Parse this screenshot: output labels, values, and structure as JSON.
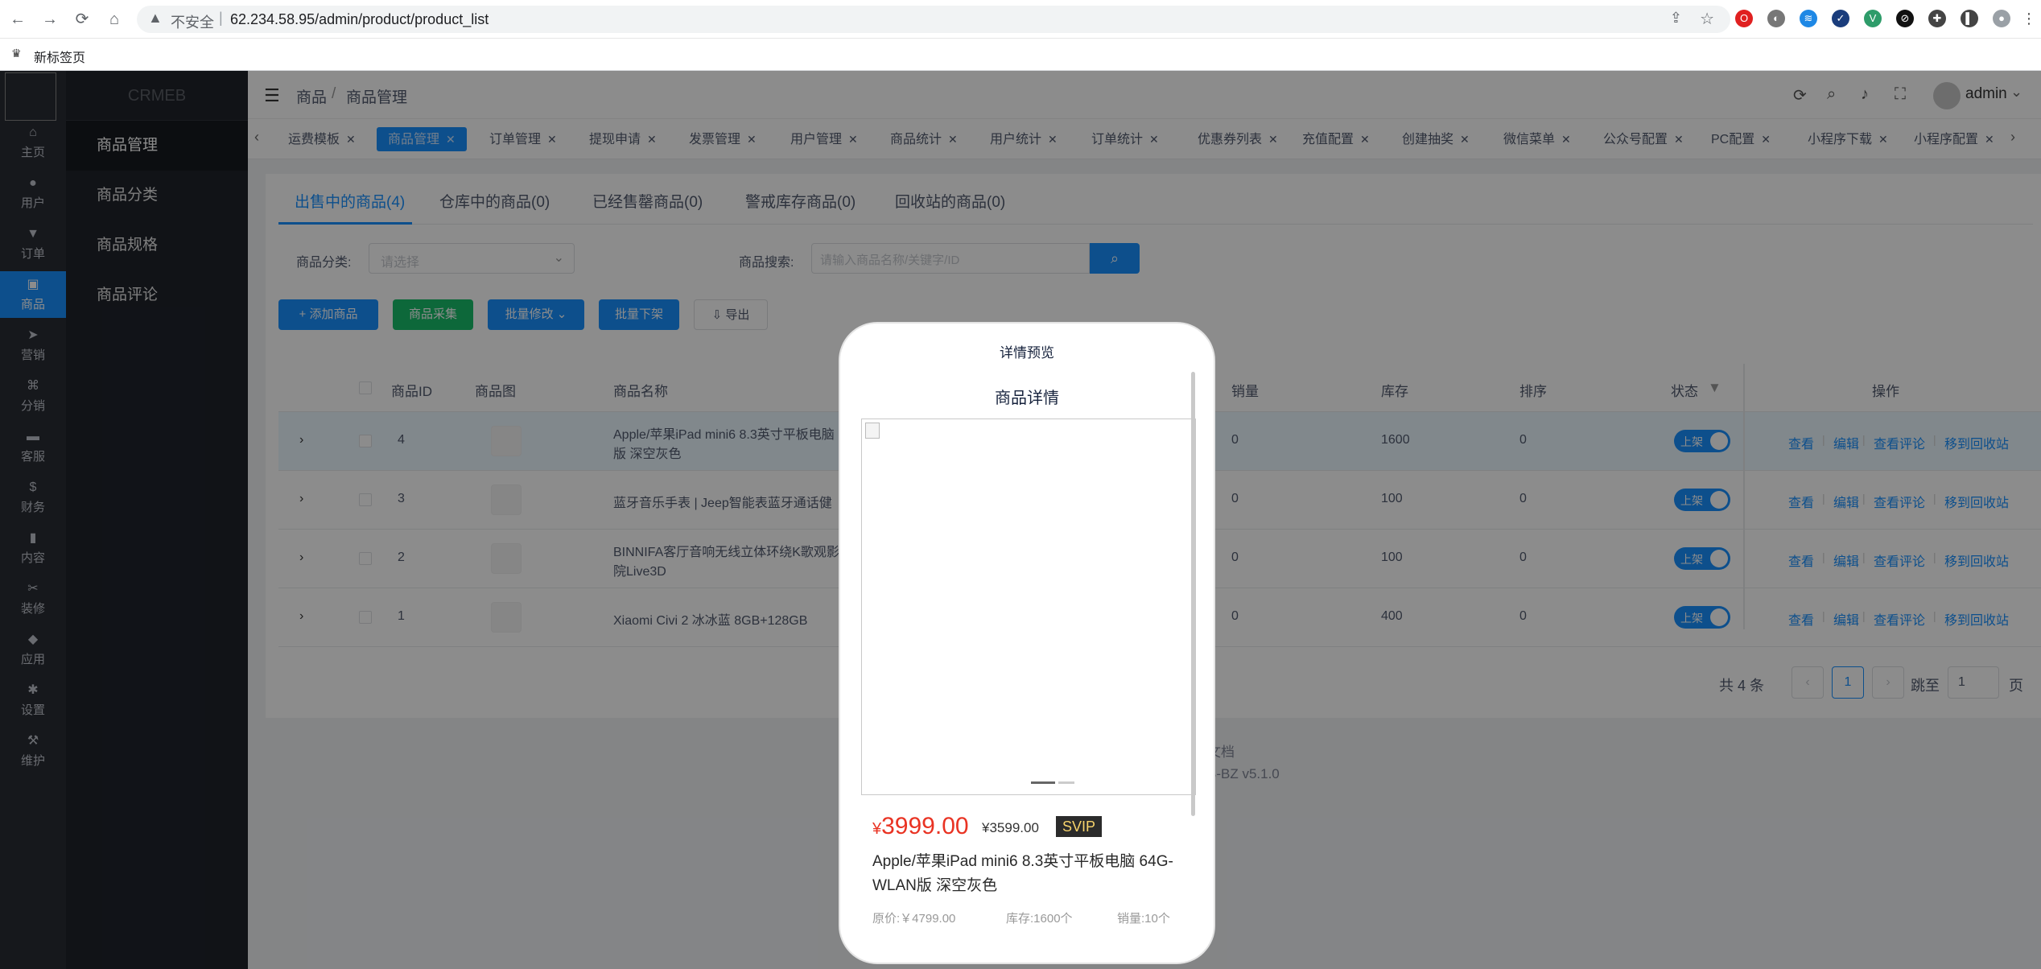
{
  "browser": {
    "back": "←",
    "forward": "→",
    "reload": "⟳",
    "home": "⌂",
    "security_icon": "warning-triangle-icon",
    "insecure_label": "不安全",
    "address_sep": "|",
    "url": "62.234.58.95/admin/product/product_list",
    "bookmark": "新标签页"
  },
  "app": {
    "brand": "CRMEB",
    "rail_items": [
      {
        "icon": "home-icon",
        "glyph": "⌂",
        "label": "主页"
      },
      {
        "icon": "user-icon",
        "glyph": "●",
        "label": "用户"
      },
      {
        "icon": "cart-icon",
        "glyph": "▼",
        "label": "订单"
      },
      {
        "icon": "goods-icon",
        "glyph": "▣",
        "label": "商品"
      },
      {
        "icon": "send-icon",
        "glyph": "➤",
        "label": "营销"
      },
      {
        "icon": "share-icon",
        "glyph": "⌘",
        "label": "分销"
      },
      {
        "icon": "chat-icon",
        "glyph": "▬",
        "label": "客服"
      },
      {
        "icon": "dollar-icon",
        "glyph": "$",
        "label": "财务"
      },
      {
        "icon": "book-icon",
        "glyph": "▮",
        "label": "内容"
      },
      {
        "icon": "tools-icon",
        "glyph": "✂",
        "label": "装修"
      },
      {
        "icon": "cube-icon",
        "glyph": "◆",
        "label": "应用"
      },
      {
        "icon": "gear-icon",
        "glyph": "✱",
        "label": "设置"
      },
      {
        "icon": "hammer-icon",
        "glyph": "⚒",
        "label": "维护"
      }
    ],
    "submenu": [
      "商品管理",
      "商品分类",
      "商品规格",
      "商品评论"
    ]
  },
  "header": {
    "breadcrumb": [
      "商品",
      "/",
      "商品管理"
    ],
    "user": "admin"
  },
  "tags": [
    "运费模板",
    "商品管理",
    "订单管理",
    "提现申请",
    "发票管理",
    "用户管理",
    "商品统计",
    "用户统计",
    "订单统计",
    "优惠券列表",
    "充值配置",
    "创建抽奖",
    "微信菜单",
    "公众号配置",
    "PC配置",
    "小程序下载",
    "小程序配置"
  ],
  "tabs": [
    "出售中的商品(4)",
    "仓库中的商品(0)",
    "已经售罄商品(0)",
    "警戒库存商品(0)",
    "回收站的商品(0)"
  ],
  "filters": {
    "category_label": "商品分类:",
    "category_placeholder": "请选择",
    "search_label": "商品搜索:",
    "search_placeholder": "请输入商品名称/关键字/ID"
  },
  "actions": {
    "add": "+ 添加商品",
    "collect": "商品采集",
    "batch_edit": "批量修改 ⌄",
    "batch_off": "批量下架",
    "export": "⇩ 导出"
  },
  "table": {
    "columns": [
      "商品ID",
      "商品图",
      "商品名称",
      "销量",
      "库存",
      "排序",
      "状态",
      "操作"
    ],
    "rows": [
      {
        "id": "4",
        "name_1": "Apple/苹果iPad mini6 8.3英寸平板电脑",
        "name_2": "版 深空灰色",
        "sales": "0",
        "stock": "1600",
        "sort": "0",
        "status": "上架"
      },
      {
        "id": "3",
        "name_1": "蓝牙音乐手表 | Jeep智能表蓝牙通话健",
        "name_2": "",
        "sales": "0",
        "stock": "100",
        "sort": "0",
        "status": "上架"
      },
      {
        "id": "2",
        "name_1": "BINNIFA客厅音响无线立体环绕K歌观影",
        "name_2": "院Live3D",
        "sales": "0",
        "stock": "100",
        "sort": "0",
        "status": "上架"
      },
      {
        "id": "1",
        "name_1": "Xiaomi Civi 2 冰冰蓝 8GB+128GB",
        "name_2": "",
        "sales": "0",
        "stock": "400",
        "sort": "0",
        "status": "上架"
      }
    ],
    "row_actions": [
      "查看",
      "编辑",
      "查看评论",
      "移到回收站"
    ]
  },
  "pager": {
    "total": "共 4 条",
    "prev": "‹",
    "current": "1",
    "next": "›",
    "jump_label": "跳至",
    "jump_value": "1",
    "page_label": "页"
  },
  "footer": {
    "line1": "文档",
    "line2": "B-BZ v5.1.0"
  },
  "preview": {
    "title": "详情预览",
    "subtitle": "商品详情",
    "price_currency": "¥",
    "price": "3999.00",
    "original_price": "¥3599.00",
    "vip_badge": "SVIP",
    "product_name": "Apple/苹果iPad mini6 8.3英寸平板电脑 64G-WLAN版 深空灰色",
    "meta_price": "原价:￥4799.00",
    "meta_stock": "库存:1600个",
    "meta_sales": "销量:10个"
  },
  "colors": {
    "primary": "#1890ff",
    "price_red": "#e93323",
    "rail_bg": "#282c34"
  }
}
